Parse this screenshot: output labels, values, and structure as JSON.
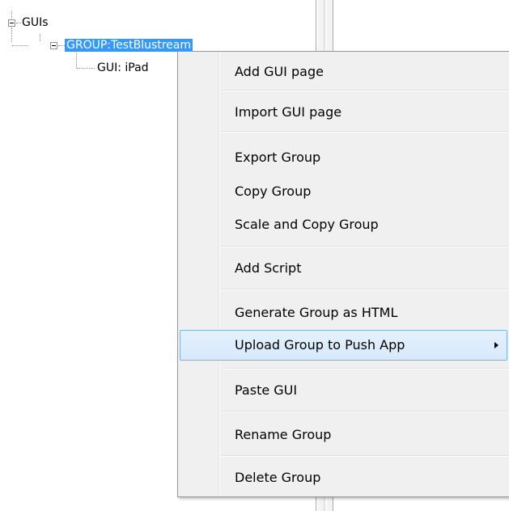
{
  "tree": {
    "root_label": "GUIs",
    "group_label": "GROUP:TestBlustream",
    "child_label": "GUI: iPad"
  },
  "context_menu": {
    "items": [
      {
        "label": "Add GUI page"
      },
      {
        "label": "Import GUI page"
      },
      {
        "label": "Export Group"
      },
      {
        "label": "Copy Group"
      },
      {
        "label": "Scale and Copy Group"
      },
      {
        "label": "Add Script"
      },
      {
        "label": "Generate Group as HTML"
      },
      {
        "label": "Upload Group to Push App",
        "highlighted": true,
        "has_submenu": true
      },
      {
        "label": "Paste GUI"
      },
      {
        "label": "Rename Group"
      },
      {
        "label": "Delete Group"
      }
    ]
  },
  "colors": {
    "selection": "#3399ff",
    "menu_background": "#f0f0f0",
    "menu_highlight_border": "#7eb4ea"
  }
}
